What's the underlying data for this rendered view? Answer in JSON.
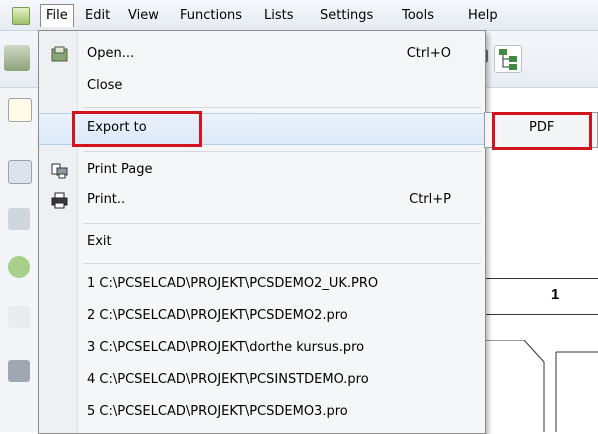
{
  "menubar": {
    "items": [
      "File",
      "Edit",
      "View",
      "Functions",
      "Lists",
      "Settings",
      "Tools",
      "Help"
    ]
  },
  "file_menu": {
    "items": [
      {
        "label": "Open...",
        "shortcut": "Ctrl+O",
        "icon": "open-icon"
      },
      {
        "label": "Close",
        "shortcut": ""
      },
      {
        "label": "Export to",
        "shortcut": "",
        "submenu": true
      },
      {
        "label": "Print Page",
        "shortcut": "",
        "icon": "print-page-icon"
      },
      {
        "label": "Print..",
        "shortcut": "Ctrl+P",
        "icon": "printer-icon"
      },
      {
        "label": "Exit",
        "shortcut": ""
      }
    ],
    "recent_files": [
      "1 C:\\PCSELCAD\\PROJEKT\\PCSDEMO2_UK.PRO",
      "2 C:\\PCSELCAD\\PROJEKT\\PCSDEMO2.pro",
      "3 C:\\PCSELCAD\\PROJEKT\\dorthe kursus.pro",
      "4 C:\\PCSELCAD\\PROJEKT\\PCSINSTDEMO.pro",
      "5 C:\\PCSELCAD\\PROJEKT\\PCSDEMO3.pro"
    ]
  },
  "submenu": {
    "items": [
      "PDF"
    ]
  },
  "canvas": {
    "column_number": "1"
  },
  "colors": {
    "highlight_box": "#d3141f",
    "menu_background": "#f5f6f7"
  }
}
